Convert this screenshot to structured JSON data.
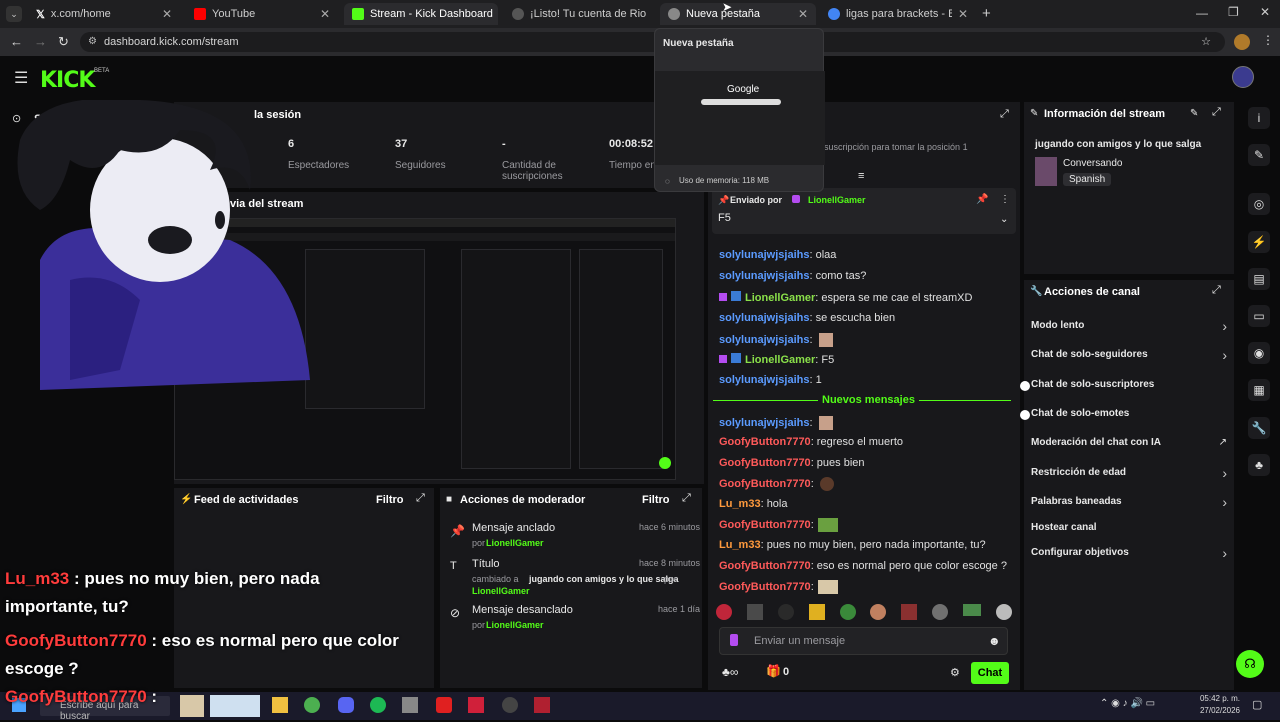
{
  "browser": {
    "tabs": [
      {
        "label": "x.com/home",
        "icon": "x-icon",
        "active": false
      },
      {
        "label": "YouTube",
        "icon": "youtube-icon",
        "active": false
      },
      {
        "label": "Stream - Kick Dashboard",
        "icon": "kick-icon",
        "active": true
      },
      {
        "label": "¡Listo! Tu cuenta de Riot ya está",
        "icon": "riot-icon",
        "active": false
      },
      {
        "label": "Nueva pestaña",
        "icon": "chrome-icon",
        "active": false
      },
      {
        "label": "ligas para brackets - Buscar con",
        "icon": "google-icon",
        "active": false
      }
    ],
    "url": "dashboard.kick.com/stream",
    "tab_preview": {
      "title": "Nueva pestaña",
      "google_label": "Google",
      "memory": "Uso de memoria: 118 MB"
    }
  },
  "kick": {
    "logo": "KICK",
    "beta": "BETA",
    "nav_stream": "Stream"
  },
  "session": {
    "title": "la sesión",
    "stats": [
      {
        "value": "6",
        "label": "Espectadores"
      },
      {
        "value": "37",
        "label": "Seguidores"
      },
      {
        "value": "-",
        "label": "Cantidad de suscripciones"
      },
      {
        "value": "00:08:52",
        "label": "Tiempo en"
      }
    ]
  },
  "preview": {
    "title": "via del stream"
  },
  "activity": {
    "title": "Feed de actividades",
    "filter": "Filtro"
  },
  "moderator": {
    "title": "Acciones de moderador",
    "filter": "Filtro",
    "items": [
      {
        "title": "Mensaje anclado",
        "time": "hace 6 minutos",
        "by": "por",
        "user": "LionellGamer"
      },
      {
        "title": "Título",
        "time": "hace 8 minutos",
        "detail_pre": "cambiado a",
        "detail_value": "jugando con amigos y lo que salga",
        "by": "por",
        "user": "LionellGamer"
      },
      {
        "title": "Mensaje desanclado",
        "time": "hace 1 día",
        "by": "por",
        "user": "LionellGamer"
      }
    ]
  },
  "chat": {
    "top_note": "suscripción para tomar la posición 1",
    "pinned": {
      "label": "Enviado por",
      "user": "LionellGamer",
      "text": "F5"
    },
    "messages": [
      {
        "user": "solylunajwjsjaihs",
        "text": ": olaa",
        "color": "blue"
      },
      {
        "user": "solylunajwjsjaihs",
        "text": ": como tas?",
        "color": "blue"
      },
      {
        "user": "LionellGamer",
        "text": ": espera se me cae el streamXD",
        "color": "green"
      },
      {
        "user": "solylunajwjsjaihs",
        "text": ": se escucha bien",
        "color": "blue"
      },
      {
        "user": "solylunajwjsjaihs",
        "text": ":",
        "color": "blue"
      },
      {
        "user": "LionellGamer",
        "text": ": F5",
        "color": "green"
      },
      {
        "user": "solylunajwjsjaihs",
        "text": ": 1",
        "color": "blue"
      }
    ],
    "new_messages": "Nuevos mensajes",
    "messages2": [
      {
        "user": "solylunajwjsjaihs",
        "text": ":",
        "color": "blue"
      },
      {
        "user": "GoofyButton7770",
        "text": ": regreso el muerto",
        "color": "red"
      },
      {
        "user": "GoofyButton7770",
        "text": ": pues bien",
        "color": "red"
      },
      {
        "user": "GoofyButton7770",
        "text": ":",
        "color": "red"
      },
      {
        "user": "Lu_m33",
        "text": ": hola",
        "color": "orange"
      },
      {
        "user": "GoofyButton7770",
        "text": ":",
        "color": "red"
      },
      {
        "user": "Lu_m33",
        "text": ": pues no muy bien, pero nada importante, tu?",
        "color": "orange"
      },
      {
        "user": "GoofyButton7770",
        "text": ": eso es normal pero que color escoge ?",
        "color": "red"
      },
      {
        "user": "GoofyButton7770",
        "text": ":",
        "color": "red"
      }
    ],
    "input_placeholder": "Enviar un mensaje",
    "count": "0",
    "send": "Chat"
  },
  "info": {
    "title": "Información del stream",
    "stream_title": "jugando con amigos y lo que salga",
    "category": "Conversando",
    "language": "Spanish"
  },
  "actions": {
    "title": "Acciones de canal",
    "items": [
      {
        "label": "Modo lento",
        "control": "chevron"
      },
      {
        "label": "Chat de solo-seguidores",
        "control": "chevron"
      },
      {
        "label": "Chat de solo-suscriptores",
        "control": "toggle"
      },
      {
        "label": "Chat de solo-emotes",
        "control": "toggle"
      },
      {
        "label": "Moderación del chat con IA",
        "control": "external"
      },
      {
        "label": "Restricción de edad",
        "control": "chevron"
      },
      {
        "label": "Palabras baneadas",
        "control": "chevron"
      },
      {
        "label": "Hostear canal",
        "control": "none"
      },
      {
        "label": "Configurar objetivos",
        "control": "chevron"
      }
    ]
  },
  "overlay_chat": [
    {
      "user": "Lu_m33",
      "text": " : pues no muy bien, pero nada"
    },
    {
      "user": "",
      "text": "importante, tu?"
    },
    {
      "user": "GoofyButton7770",
      "text": " : eso es normal pero que color"
    },
    {
      "user": "",
      "text": "escoge ?"
    },
    {
      "user": "GoofyButton7770",
      "text": " :"
    }
  ],
  "taskbar": {
    "search": "Escribe aquí para buscar",
    "time": "05:42 p. m.",
    "date": "27/02/2026"
  },
  "colors": {
    "kick_green": "#53fc18",
    "panel": "#18181b",
    "bg": "#0b0b0c"
  }
}
